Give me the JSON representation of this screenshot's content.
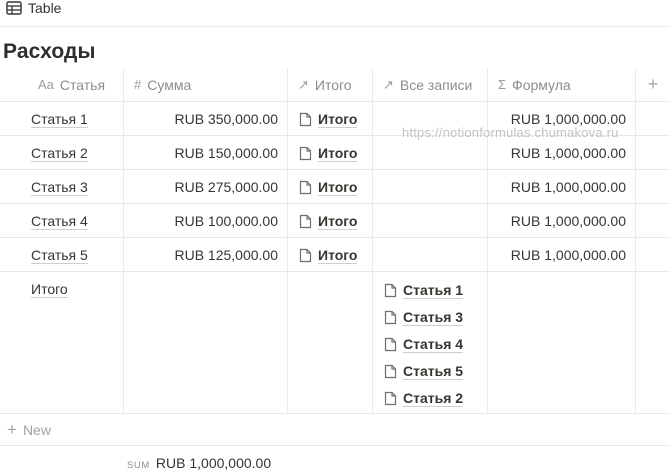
{
  "view": {
    "icon": "table-icon",
    "label": "Table"
  },
  "page": {
    "title": "Расходы"
  },
  "columns": [
    {
      "icon": "text-property-icon",
      "icon_text": "Aa",
      "label": "Статья"
    },
    {
      "icon": "number-property-icon",
      "icon_text": "#",
      "label": "Сумма"
    },
    {
      "icon": "relation-property-icon",
      "icon_text": "↗",
      "label": "Итого"
    },
    {
      "icon": "relation-property-icon",
      "icon_text": "↗",
      "label": "Все записи"
    },
    {
      "icon": "formula-property-icon",
      "icon_text": "Σ",
      "label": "Формула"
    }
  ],
  "add_column": {
    "icon": "plus-icon",
    "text": "+"
  },
  "rows": [
    {
      "title": "Статья 1",
      "amount": "RUB 350,000.00",
      "total": "Итого",
      "formula": "RUB 1,000,000.00"
    },
    {
      "title": "Статья 2",
      "amount": "RUB 150,000.00",
      "total": "Итого",
      "formula": "RUB 1,000,000.00"
    },
    {
      "title": "Статья 3",
      "amount": "RUB 275,000.00",
      "total": "Итого",
      "formula": "RUB 1,000,000.00"
    },
    {
      "title": "Статья 4",
      "amount": "RUB 100,000.00",
      "total": "Итого",
      "formula": "RUB 1,000,000.00"
    },
    {
      "title": "Статья 5",
      "amount": "RUB 125,000.00",
      "total": "Итого",
      "formula": "RUB 1,000,000.00"
    }
  ],
  "summary_row": {
    "title": "Итого",
    "all_records": [
      "Статья 1",
      "Статья 3",
      "Статья 4",
      "Статья 5",
      "Статья 2"
    ]
  },
  "watermark": "https://notionformulas.chumakova.ru",
  "new_row": {
    "icon": "plus-icon",
    "plus": "+",
    "label": "New"
  },
  "footer": {
    "sum_label": "SUM",
    "sum_value": "RUB 1,000,000.00"
  },
  "colors": {
    "text": "#37352f",
    "muted": "#8e8d89",
    "border": "#e9e9e7",
    "watermark": "#c4c3bf"
  }
}
